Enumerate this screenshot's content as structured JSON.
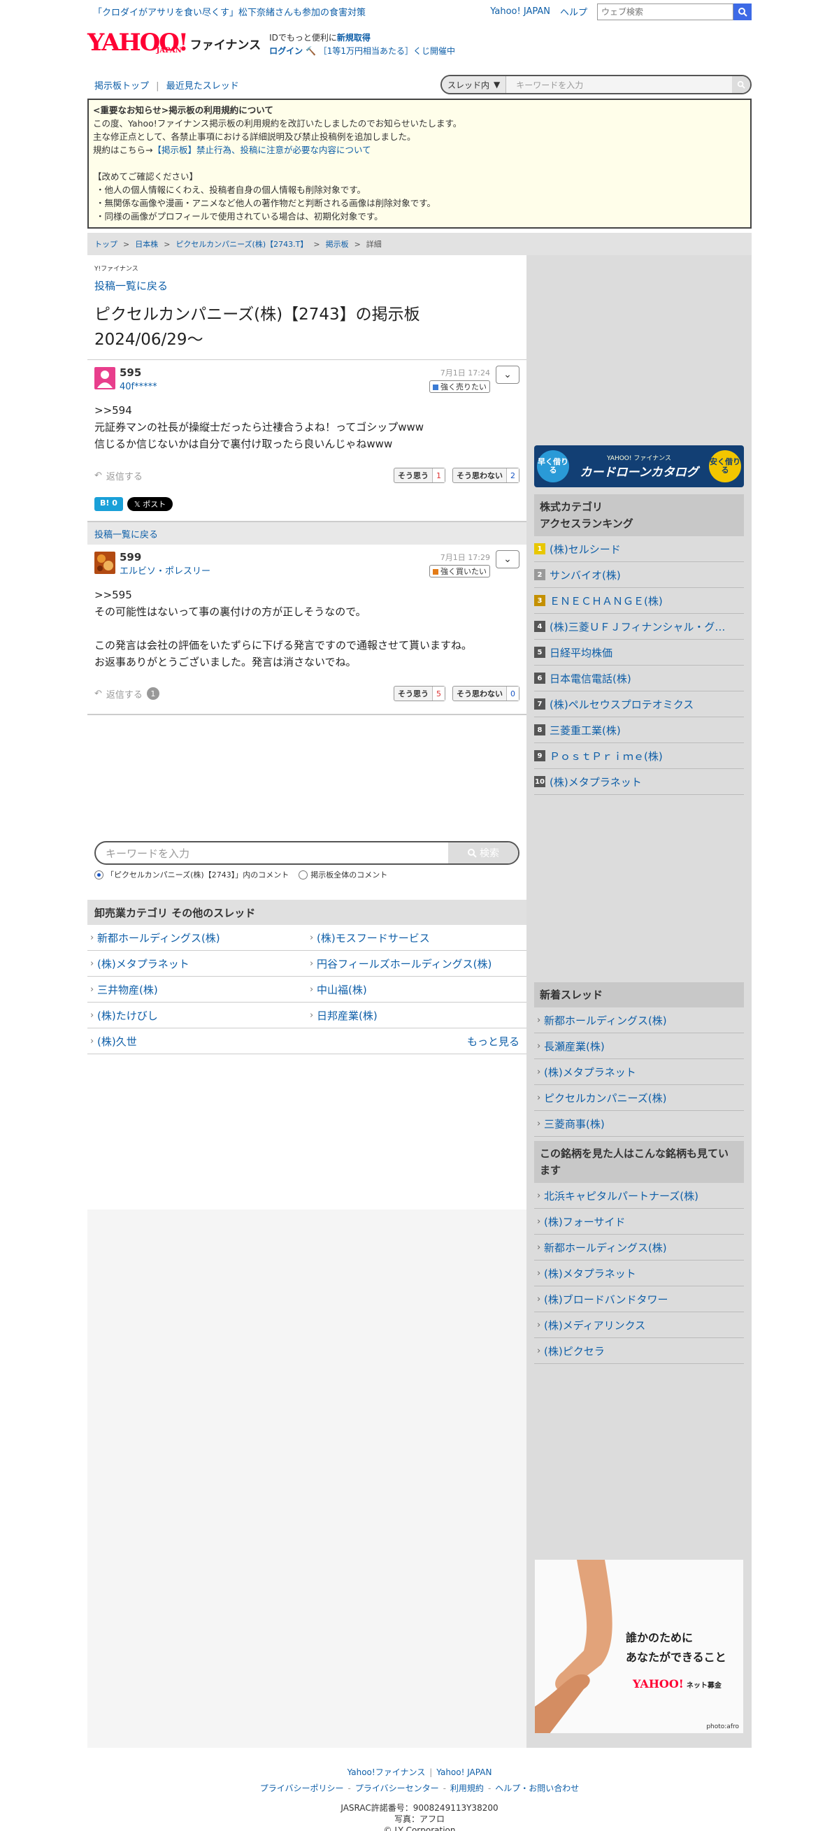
{
  "topbar": {
    "news": "「クロダイがアサリを食い尽くす」松下奈緒さんも参加の食害対策",
    "yahoo_japan": "Yahoo! JAPAN",
    "help": "ヘルプ",
    "web_search_placeholder": "ウェブ検索"
  },
  "header": {
    "logo_text": "YAHOO!",
    "logo_sub": "JAPAN",
    "logo_finance": "ファイナンス",
    "id_text": "IDでもっと便利に",
    "signup": "新規取得",
    "login": "ログイン",
    "campaign": "［1等1万円相当あたる］くじ開催中"
  },
  "nav": {
    "board_top": "掲示板トップ",
    "separator": "|",
    "recent_threads": "最近見たスレッド",
    "scope_select": "スレッド内",
    "keyword_placeholder": "キーワードを入力"
  },
  "notice": {
    "title": "<重要なお知らせ>掲示板の利用規約について",
    "line1": "この度、Yahoo!ファイナンス掲示板の利用規約を改訂いたしましたのでお知らせいたします。",
    "line2": "主な修正点として、各禁止事項における詳細説明及び禁止投稿例を追加しました。",
    "line3_prefix": "規約はこちら→",
    "line3_link": "【掲示板】禁止行為、投稿に注意が必要な内容について",
    "confirm_title": "【改めてご確認ください】",
    "bullet1": "・他人の個人情報にくわえ、投稿者自身の個人情報も削除対象です。",
    "bullet2": "・無関係な画像や漫画・アニメなど他人の著作物だと判断される画像は削除対象です。",
    "bullet3": "・同様の画像がプロフィールで使用されている場合は、初期化対象です。"
  },
  "breadcrumb": {
    "top": "トップ",
    "jp_stocks": "日本株",
    "company": "ピクセルカンパニーズ(株)【2743.T】",
    "board": "掲示板",
    "detail": "詳細",
    "sep": ">"
  },
  "main": {
    "mini_logo": "Y!ファイナンス",
    "back_to_list": "投稿一覧に戻る",
    "title": "ピクセルカンパニーズ(株)【2743】の掲示板 2024/06/29〜",
    "posts": [
      {
        "number": "595",
        "user": "40f*****",
        "date": "7月1日 17:24",
        "sentiment": "強く売りたい",
        "sentiment_color": "#3b7bd4",
        "body": ">>594\n元証券マンの社長が操縦士だったら辻褄合うよね！ってゴシップwww\n信じるか信じないかは自分で裏付け取ったら良いんじゃねwww",
        "reply": "返信する",
        "reply_count": "",
        "agree_label": "そう思う",
        "agree": "1",
        "disagree_label": "そう思わない",
        "disagree": "2"
      },
      {
        "number": "599",
        "user": "エルビソ・ポレスリー",
        "date": "7月1日 17:29",
        "sentiment": "強く買いたい",
        "sentiment_color": "#e37b16",
        "body": ">>595\nその可能性はないって事の裏付けの方が正しそうなので。\n\nこの発言は会社の評価をいたずらに下げる発言ですので通報させて貰いますね。\nお返事ありがとうございました。発言は消さないでね。",
        "reply": "返信する",
        "reply_count": "1",
        "agree_label": "そう思う",
        "agree": "5",
        "disagree_label": "そう思わない",
        "disagree": "0"
      }
    ],
    "share_hatena": "B! 0",
    "share_x": "𝕏 ポスト",
    "back_bar": "投稿一覧に戻る",
    "keyword_placeholder": "キーワードを入力",
    "search_button": "検索",
    "radio_this": "「ピクセルカンパニーズ(株)【2743】」内のコメント",
    "radio_all": "掲示板全体のコメント",
    "category_title": "卸売業カテゴリ その他のスレッド",
    "category_items": [
      "新都ホールディングス(株)",
      "(株)モスフードサービス",
      "(株)メタプラネット",
      "円谷フィールズホールディングス(株)",
      "三井物産(株)",
      "中山福(株)",
      "(株)たけびし",
      "日邦産業(株)",
      "(株)久世"
    ],
    "more": "もっと見る"
  },
  "sidebar": {
    "ad_left": "早く借りる",
    "ad_brand": "YAHOO! ファイナンス",
    "ad_title": "カードローンカタログ",
    "ad_right": "安く借りる",
    "ranking_title": "株式カテゴリ\nアクセスランキング",
    "ranking": [
      "(株)セルシード",
      "サンバイオ(株)",
      "ＥＮＥＣＨＡＮＧＥ(株)",
      "(株)三菱ＵＦＪフィナンシャル・グ…",
      "日経平均株価",
      "日本電信電話(株)",
      "(株)ペルセウスプロテオミクス",
      "三菱重工業(株)",
      "ＰｏｓｔＰｒｉｍｅ(株)",
      "(株)メタプラネット"
    ],
    "new_threads_title": "新着スレッド",
    "new_threads": [
      "新都ホールディングス(株)",
      "長瀬産業(株)",
      "(株)メタプラネット",
      "ピクセルカンパニーズ(株)",
      "三菱商事(株)"
    ],
    "viewed_title": "この銘柄を見た人はこんな銘柄も見ています",
    "viewed": [
      "北浜キャピタルパートナーズ(株)",
      "(株)フォーサイド",
      "新都ホールディングス(株)",
      "(株)メタプラネット",
      "(株)ブロードバンドタワー",
      "(株)メディアリンクス",
      "(株)ピクセラ"
    ],
    "ad2_line1": "誰かのために",
    "ad2_line2": "あなたができること",
    "ad2_brand": "YAHOO!",
    "ad2_brand_sub": "ネット募金",
    "ad2_credit": "photo:afro"
  },
  "footer": {
    "yf": "Yahoo!ファイナンス",
    "yj": "Yahoo! JAPAN",
    "privacy_policy": "プライバシーポリシー",
    "privacy_center": "プライバシーセンター",
    "terms": "利用規約",
    "help": "ヘルプ・お問い合わせ",
    "jasrac": "JASRAC許諾番号：9008249113Y38200",
    "photo": "写真：アフロ",
    "copyright": "© LY Corporation"
  }
}
